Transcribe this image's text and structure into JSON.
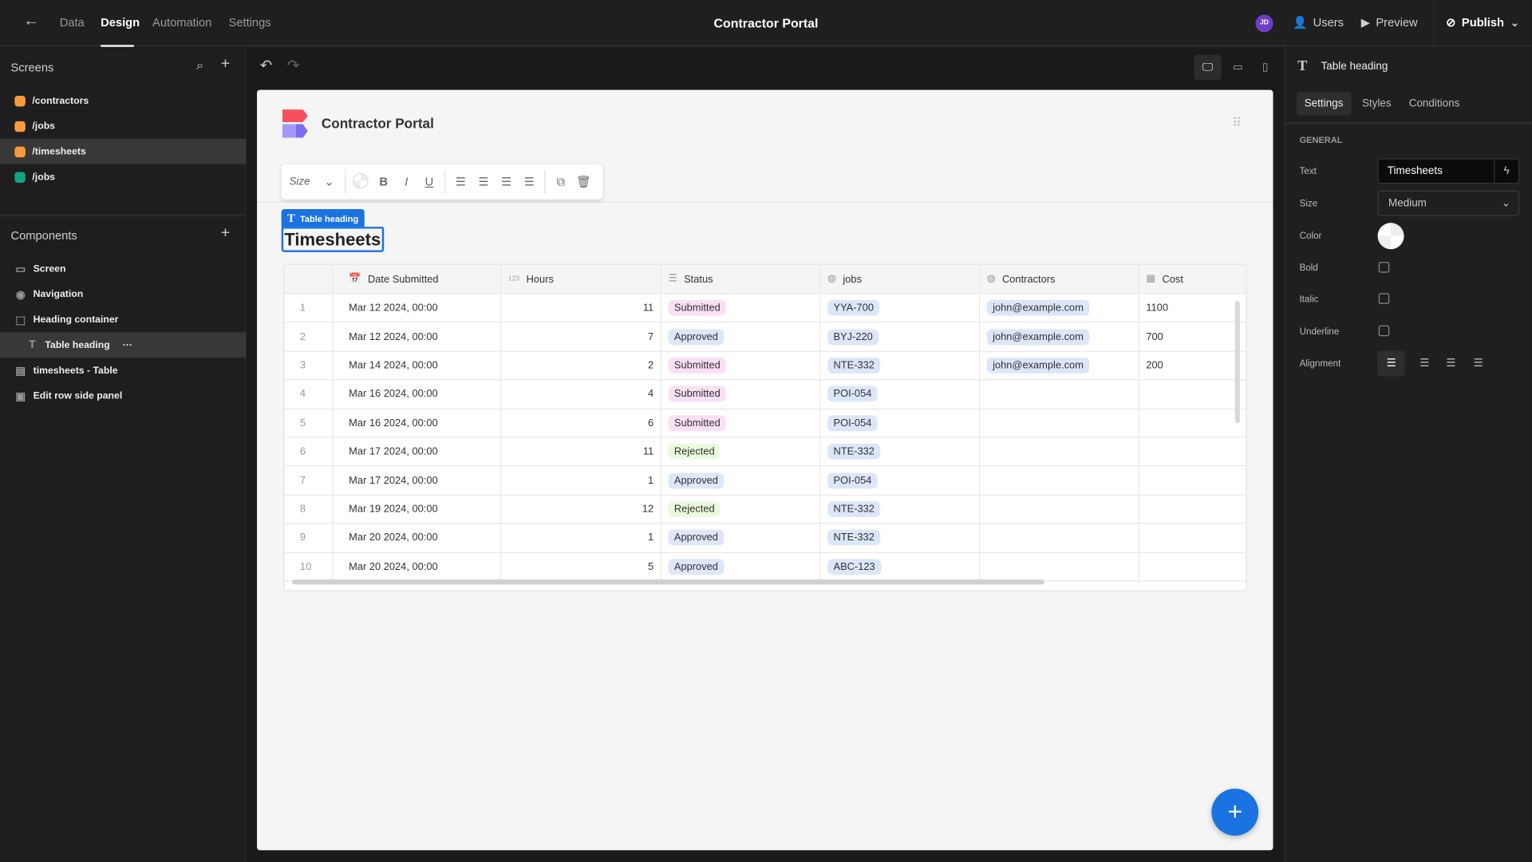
{
  "topbar": {
    "nav": [
      "Data",
      "Design",
      "Automation",
      "Settings"
    ],
    "active": "Design",
    "title": "Contractor Portal",
    "avatar": "JD",
    "users": "Users",
    "preview": "Preview",
    "publish": "Publish"
  },
  "screens": {
    "heading": "Screens",
    "items": [
      {
        "label": "/contractors",
        "color": "#f79a3e"
      },
      {
        "label": "/jobs",
        "color": "#f79a3e"
      },
      {
        "label": "/timesheets",
        "color": "#f79a3e",
        "selected": true
      },
      {
        "label": "/jobs",
        "color": "#12a37f"
      }
    ]
  },
  "components": {
    "heading": "Components",
    "items": [
      {
        "label": "Screen"
      },
      {
        "label": "Navigation"
      },
      {
        "label": "Heading container"
      },
      {
        "label": "Table heading",
        "selected": true
      },
      {
        "label": "timesheets - Table"
      },
      {
        "label": "Edit row side panel"
      }
    ]
  },
  "canvas": {
    "app_title": "Contractor Portal",
    "format_size": "Size",
    "tag": "Table heading",
    "heading": "Timesheets"
  },
  "table": {
    "columns": [
      "Date Submitted",
      "Hours",
      "Status",
      "jobs",
      "Contractors",
      "Cost"
    ],
    "status_colors": {
      "Submitted": "#fbdff5",
      "Approved": "#dde6fa",
      "Rejected": "#ebfadf"
    },
    "pill_color": "#dce6f9",
    "rows": [
      {
        "n": "1",
        "date": "Mar 12 2024, 00:00",
        "hours": "11",
        "status": "Submitted",
        "job": "YYA-700",
        "contractor": "john@example.com",
        "cost": "1100"
      },
      {
        "n": "2",
        "date": "Mar 12 2024, 00:00",
        "hours": "7",
        "status": "Approved",
        "job": "BYJ-220",
        "contractor": "john@example.com",
        "cost": "700"
      },
      {
        "n": "3",
        "date": "Mar 14 2024, 00:00",
        "hours": "2",
        "status": "Submitted",
        "job": "NTE-332",
        "contractor": "john@example.com",
        "cost": "200"
      },
      {
        "n": "4",
        "date": "Mar 16 2024, 00:00",
        "hours": "4",
        "status": "Submitted",
        "job": "POI-054",
        "contractor": "",
        "cost": ""
      },
      {
        "n": "5",
        "date": "Mar 16 2024, 00:00",
        "hours": "6",
        "status": "Submitted",
        "job": "POI-054",
        "contractor": "",
        "cost": ""
      },
      {
        "n": "6",
        "date": "Mar 17 2024, 00:00",
        "hours": "11",
        "status": "Rejected",
        "job": "NTE-332",
        "contractor": "",
        "cost": ""
      },
      {
        "n": "7",
        "date": "Mar 17 2024, 00:00",
        "hours": "1",
        "status": "Approved",
        "job": "POI-054",
        "contractor": "",
        "cost": ""
      },
      {
        "n": "8",
        "date": "Mar 19 2024, 00:00",
        "hours": "12",
        "status": "Rejected",
        "job": "NTE-332",
        "contractor": "",
        "cost": ""
      },
      {
        "n": "9",
        "date": "Mar 20 2024, 00:00",
        "hours": "1",
        "status": "Approved",
        "job": "NTE-332",
        "contractor": "",
        "cost": ""
      },
      {
        "n": "10",
        "date": "Mar 20 2024, 00:00",
        "hours": "5",
        "status": "Approved",
        "job": "ABC-123",
        "contractor": "",
        "cost": ""
      }
    ]
  },
  "panel": {
    "title": "Table heading",
    "tabs": [
      "Settings",
      "Styles",
      "Conditions"
    ],
    "section": "GENERAL",
    "text_label": "Text",
    "text_value": "Timesheets",
    "size_label": "Size",
    "size_value": "Medium",
    "color_label": "Color",
    "bold_label": "Bold",
    "italic_label": "Italic",
    "underline_label": "Underline",
    "alignment_label": "Alignment",
    "bold": false,
    "italic": false,
    "underline": false,
    "alignment": "left"
  }
}
